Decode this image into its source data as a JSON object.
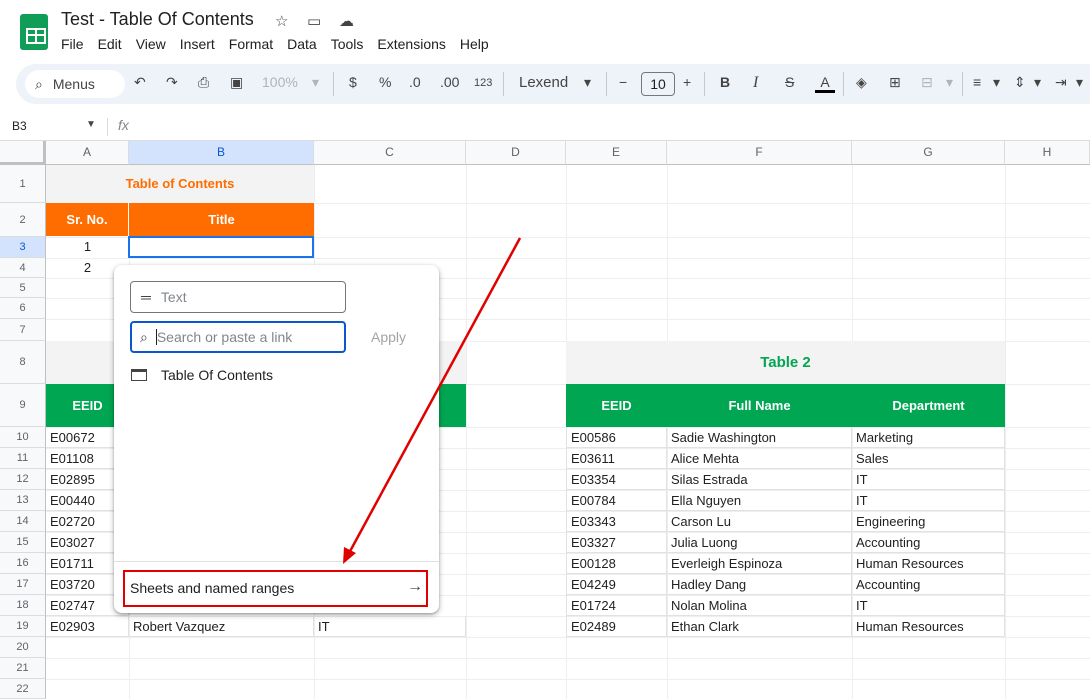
{
  "window": {
    "doc_title": "Test - Table Of Contents",
    "menu": [
      "File",
      "Edit",
      "View",
      "Insert",
      "Format",
      "Data",
      "Tools",
      "Extensions",
      "Help"
    ]
  },
  "toolbar": {
    "menus_label": "Menus",
    "zoom": "100%",
    "currency": "$",
    "percent": "%",
    "dec_decrease": ".0",
    "dec_increase": ".00",
    "number_format": "123",
    "font": "Lexend",
    "font_size": "10",
    "bold": "B",
    "italic": "I",
    "strike": "S",
    "text_color": "A"
  },
  "formula_bar": {
    "name_box": "B3",
    "fx": "fx"
  },
  "columns": [
    "A",
    "B",
    "C",
    "D",
    "E",
    "F",
    "G",
    "H"
  ],
  "rows": [
    "1",
    "2",
    "3",
    "4",
    "5",
    "6",
    "7",
    "8",
    "9",
    "10",
    "11",
    "12",
    "13",
    "14",
    "15",
    "16",
    "17",
    "18",
    "19",
    "20",
    "21",
    "22"
  ],
  "table_of_contents": {
    "title": "Table of Contents",
    "header_srno": "Sr. No.",
    "header_title": "Title",
    "rows": [
      "1",
      "2"
    ]
  },
  "table1": {
    "header_eeid": "EEID",
    "eeids": [
      "E00672",
      "E01108",
      "E02895",
      "E00440",
      "E02720",
      "E03027",
      "E01711",
      "E03720",
      "E02747",
      "E02903"
    ],
    "last_row_name": "Robert Vazquez",
    "last_row_dept": "IT"
  },
  "table2": {
    "title": "Table 2",
    "headers": [
      "EEID",
      "Full Name",
      "Department"
    ],
    "rows": [
      [
        "E00586",
        "Sadie Washington",
        "Marketing"
      ],
      [
        "E03611",
        "Alice Mehta",
        "Sales"
      ],
      [
        "E03354",
        "Silas Estrada",
        "IT"
      ],
      [
        "E00784",
        "Ella Nguyen",
        "IT"
      ],
      [
        "E03343",
        "Carson Lu",
        "Engineering"
      ],
      [
        "E03327",
        "Julia Luong",
        "Accounting"
      ],
      [
        "E00128",
        "Everleigh Espinoza",
        "Human Resources"
      ],
      [
        "E04249",
        "Hadley Dang",
        "Accounting"
      ],
      [
        "E01724",
        "Nolan Molina",
        "IT"
      ],
      [
        "E02489",
        "Ethan Clark",
        "Human Resources"
      ]
    ]
  },
  "link_popup": {
    "text_placeholder": "Text",
    "search_placeholder": "Search or paste a link",
    "apply_label": "Apply",
    "suggestion": "Table Of Contents",
    "sheets_named_ranges": "Sheets and named ranges"
  },
  "colors": {
    "orange": "#ff6d01",
    "green": "#00a651",
    "annotation_red": "#e00000"
  }
}
